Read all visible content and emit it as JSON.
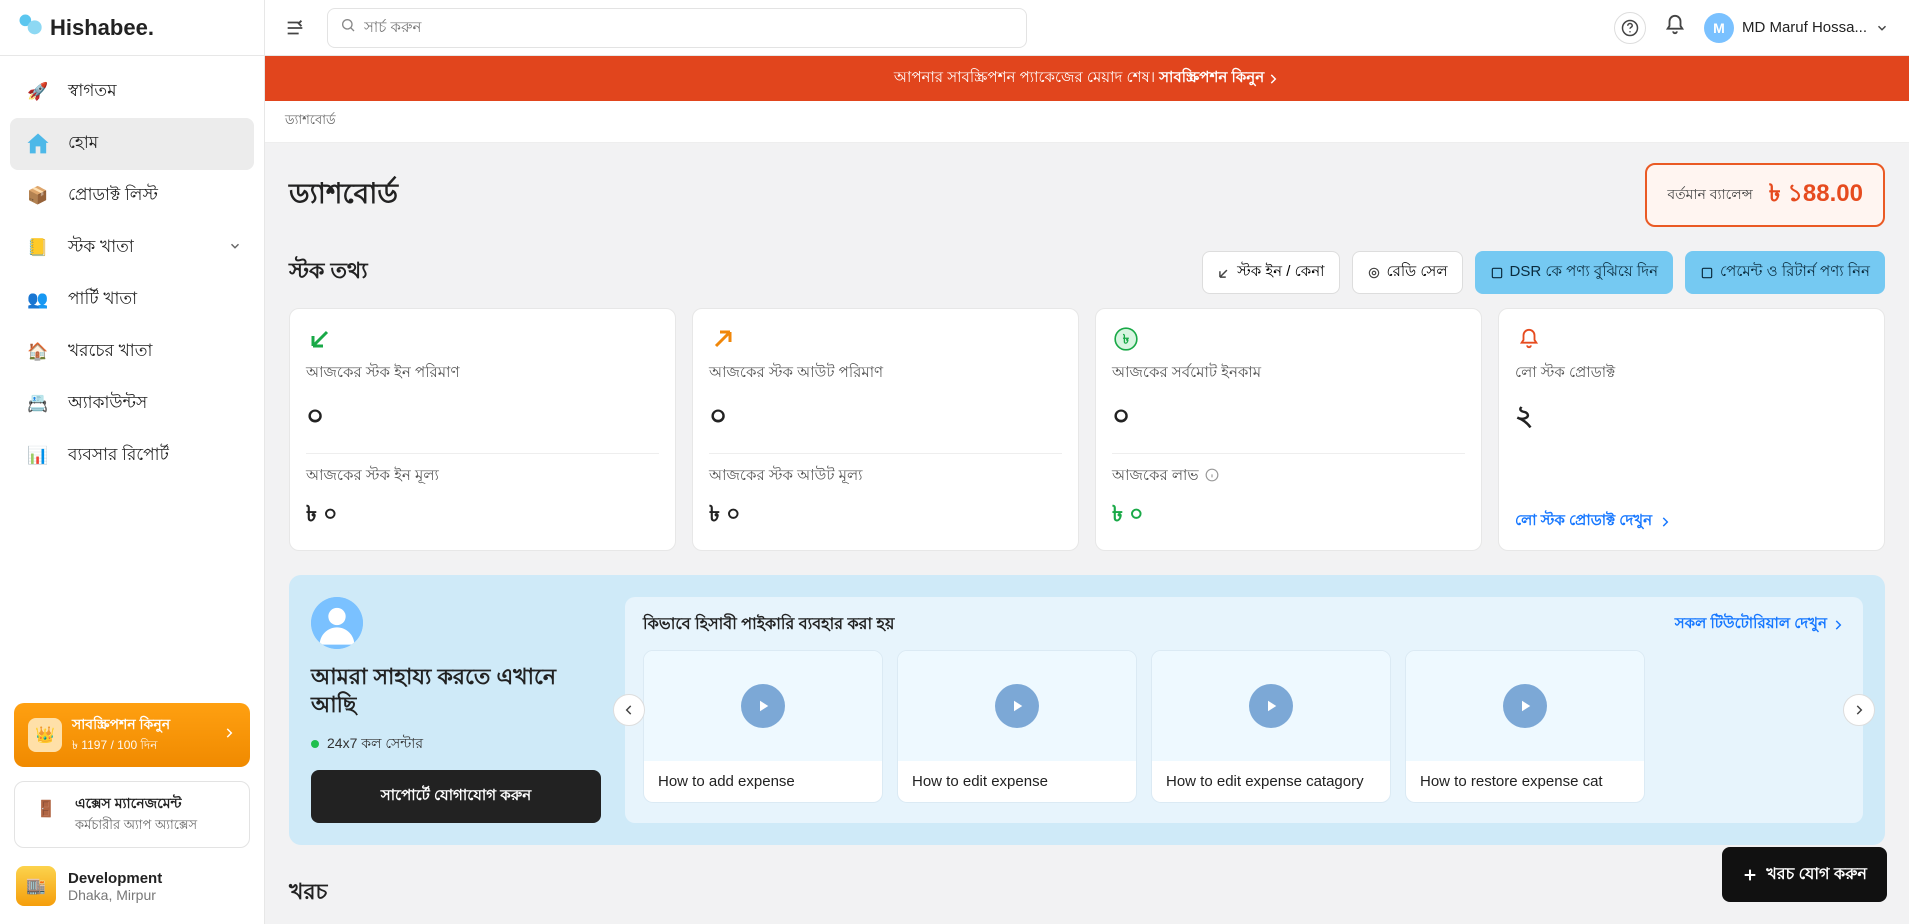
{
  "brand": "Hishabee.",
  "search_placeholder": "সার্চ করুন",
  "user": {
    "initial": "M",
    "name": "MD Maruf Hossa..."
  },
  "alert": {
    "text": "আপনার সাবস্ক্রিপশন প্যাকেজের মেয়াদ শেষ।",
    "cta": "সাবস্ক্রিপশন কিনুন"
  },
  "breadcrumb": "ড্যাশবোর্ড",
  "page_title": "ড্যাশবোর্ড",
  "balance": {
    "label": "বর্তমান ব্যালেন্স",
    "value": "৳ ১88.00"
  },
  "nav": {
    "items": [
      {
        "label": "স্বাগতম"
      },
      {
        "label": "হোম"
      },
      {
        "label": "প্রোডাক্ট লিস্ট"
      },
      {
        "label": "স্টক খাতা",
        "expandable": true
      },
      {
        "label": "পার্টি খাতা"
      },
      {
        "label": "খরচের খাতা"
      },
      {
        "label": "অ্যাকাউন্টস"
      },
      {
        "label": "ব্যবসার রিপোর্ট"
      }
    ]
  },
  "subscription": {
    "title": "সাবস্ক্রিপশন কিনুন",
    "sub": "৳ 1197 / 100 দিন"
  },
  "access": {
    "title": "এক্সেস ম্যানেজমেন্ট",
    "sub": "কর্মচারীর অ্যাপ অ্যাক্সেস"
  },
  "org": {
    "name": "Development",
    "loc": "Dhaka, Mirpur"
  },
  "stock": {
    "heading": "স্টক তথ্য",
    "btn_in": "স্টক ইন / কেনা",
    "btn_ready": "রেডি সেল",
    "btn_dsr": "DSR কে পণ্য বুঝিয়ে দিন",
    "btn_pay": "পেমেন্ট ও রিটার্ন পণ্য নিন",
    "cards": [
      {
        "label": "আজকের স্টক ইন পরিমাণ",
        "value": "০",
        "sublabel": "আজকের স্টক ইন মূল্য",
        "subval": "৳ ০"
      },
      {
        "label": "আজকের স্টক আউট পরিমাণ",
        "value": "০",
        "sublabel": "আজকের স্টক আউট মূল্য",
        "subval": "৳ ০"
      },
      {
        "label": "আজকের সর্বমোট ইনকাম",
        "value": "০",
        "sublabel": "আজকের লাভ",
        "subval": "৳ ০"
      },
      {
        "label": "লো স্টক প্রোডাক্ট",
        "value": "২",
        "link": "লো স্টক প্রোডাক্ট দেখুন"
      }
    ]
  },
  "help": {
    "title": "আমরা সাহায্য করতে এখানে আছি",
    "status": "24x7 কল সেন্টার",
    "btn": "সাপোর্টে যোগাযোগ করুন",
    "tutorials_heading": "কিভাবে হিসাবী পাইকারি ব্যবহার করা হয়",
    "all_link": "সকল টিউটোরিয়াল দেখুন",
    "videos": [
      {
        "title": "How to add expense"
      },
      {
        "title": "How to edit expense"
      },
      {
        "title": "How to edit expense catagory"
      },
      {
        "title": "How to restore expense cat"
      }
    ]
  },
  "khoroch": {
    "heading": "খরচ"
  },
  "fab": "খরচ যোগ করুন"
}
